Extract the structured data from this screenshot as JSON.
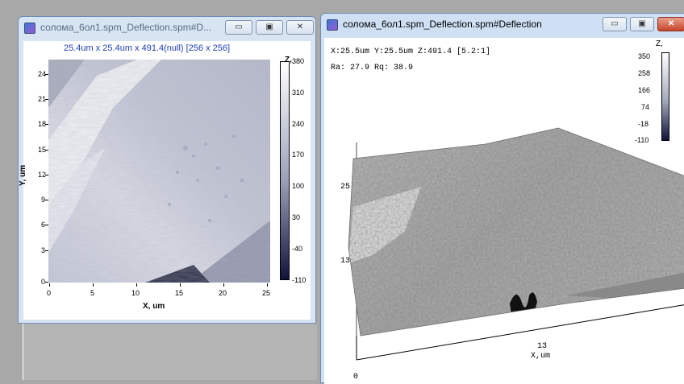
{
  "window_left": {
    "title": "солома_6ол1.spm_Deflection.spm#D...",
    "image_info": "25.4um x 25.4um x 491.4(null) [256 x 256]",
    "y_axis_label": "Y, um",
    "x_axis_label": "X, um",
    "y_ticks": [
      "24",
      "21",
      "18",
      "15",
      "12",
      "9",
      "6",
      "3",
      "0"
    ],
    "x_ticks": [
      "0",
      "5",
      "10",
      "15",
      "20",
      "25"
    ],
    "z_label": "Z,",
    "z_ticks": [
      "380",
      "310",
      "240",
      "170",
      "100",
      "30",
      "-40",
      "-110"
    ],
    "buttons": {
      "minimize": "▭",
      "maximize": "▣",
      "close": "✕"
    }
  },
  "window_right": {
    "title": "солома_6ол1.spm_Deflection.spm#Deflection",
    "cursor_readout": "X:25.5um   Y:25.5um   Z:491.4 [5.2:1]",
    "roughness": "Ra: 27.9   Rq: 38.9",
    "y_ticks": [
      "25",
      "13"
    ],
    "x_tick": "13",
    "x_axis_label": "X,um",
    "origin": "0",
    "z_label": "Z,",
    "z_ticks": [
      "350",
      "258",
      "166",
      "74",
      "-18",
      "-110"
    ],
    "buttons": {
      "minimize": "▭",
      "maximize": "▣",
      "close": "✕"
    }
  },
  "colors": {
    "titlebar_active": "#cfe0f4",
    "titlebar_inactive": "#d7e4f2",
    "image_info_text": "#1f3fb8",
    "close_button": "#c6442b"
  }
}
